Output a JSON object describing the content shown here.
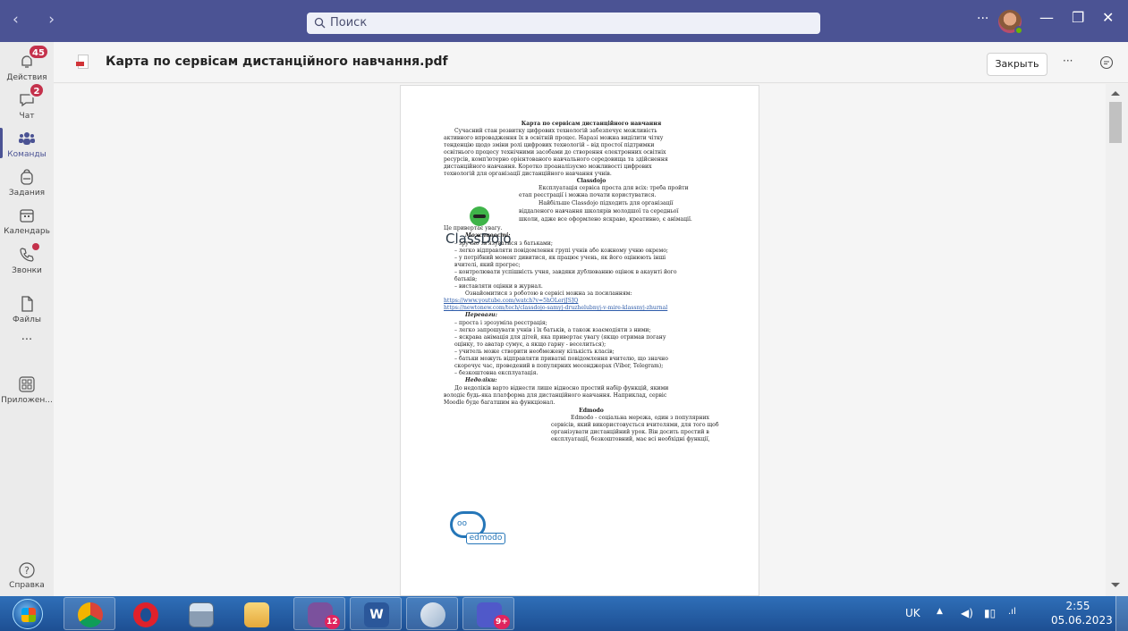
{
  "titlebar": {
    "search_placeholder": "Поиск",
    "more": "···",
    "nav": "‹  ›"
  },
  "rail": {
    "items": [
      {
        "label": "Действия",
        "badge": "45"
      },
      {
        "label": "Чат",
        "badge": "2"
      },
      {
        "label": "Команды",
        "active": true
      },
      {
        "label": "Задания"
      },
      {
        "label": "Календарь"
      },
      {
        "label": "Звонки",
        "dot": true
      },
      {
        "label": "Файлы"
      },
      {
        "label": "···"
      },
      {
        "label": "Приложен..."
      }
    ],
    "help": "Справка"
  },
  "header": {
    "title": "Карта по сервісам дистанційного навчання.pdf",
    "close": "Закрыть",
    "more": "···"
  },
  "document": {
    "title": "Карта по сервісам дистанційного навчання",
    "intro": [
      "Сучасний стан розвитку цифрових технологій забезпечує можливість",
      "активного впровадження їх в освітній процес. Наразі можна виділити чітку",
      "тенденцію щодо зміни ролі цифрових технологій – від простої підтримки",
      "освітнього процесу технічними засобами до створення електронних освітніх",
      "ресурсів, комп'ютерно орієнтованого навчального середовища та здійснення",
      "дистанційного навчання. Коротко проаналізуємо можливості цифрових",
      "технологій для організації дистанційного навчання учнів."
    ],
    "classdojo_heading": "Classdojo",
    "classdojo_logo": "ClassDojo",
    "classdojo_text": [
      "Експлуатація сервіса проста для всіх: треба пройти",
      "етап реєстрації і можна почати користуватися.",
      "Найбільше Classdojo підходить для організації",
      "віддаленого навчання школярів молодшої та середньої",
      "школи, адже все оформлено яскраво, креативно, є анімації.",
      "Це привертає увагу."
    ],
    "features_heading": "Можливості:",
    "features": [
      "–  зручно зв'язуватися з батьками;",
      "–  легко відправляти повідомлення групі учнів або кожному учню окремо;",
      "–  у потрібний момент дивитися, як працює учень, як його оцінюють інші",
      "    вчителі, який прогрес;",
      "–  контролювати успішність учня, завдяки дублюванню оцінок в акаунті його",
      "    батьків;",
      "–  виставляти оцінки в журнал."
    ],
    "links_intro": "Ознайомитися з роботою в сервісі можна за посиланням:",
    "links": [
      "https://www.youtube.com/watch?v=5hOLerjJSJQ",
      "https://newtonew.com/tech/classdojo-samyj-druzhelubnyj-v-mire-klassnyj-zhurnal"
    ],
    "advantages_heading": "Переваги:",
    "advantages": [
      "–  проста і зрозуміла реєстрація;",
      "–  легко запрошувати учнів і їх батьків, а також взаємодіяти з ними;",
      "–  яскрава анімація для дітей, яка привертає увагу (якщо отримав погану",
      "    оцінку, то аватар сумує, а якщо гарну - веселиться);",
      "–  учитель може створити необмежену кількість класів;",
      "–  батьки можуть відправляти приватні повідомлення вчителю, що значно",
      "    скорочує час, проведений в популярних месенджерах (Viber, Telegram);",
      "–  безкоштовна експлуатація."
    ],
    "drawbacks_heading": "Недоліки:",
    "drawbacks": [
      "До недоліків варто віднести лише відносно простий набір функцій, якими",
      "володіє будь-яка платформа для дистанційного навчання. Наприклад, сервіс",
      "Moodle буде багатшим на функціонал."
    ],
    "edmodo_heading": "Edmodo",
    "edmodo_logo": "edmodo",
    "edmodo_text": [
      "Edmodo - соціальна мережа, один з популярних",
      "сервісів, який використовується вчителями, для того щоб",
      "організувати дистанційний урок. Він досить простий в",
      "експлуатації, безкоштовний, має всі необхідні функції,"
    ]
  },
  "taskbar": {
    "apps": [
      {
        "name": "chrome",
        "badge": ""
      },
      {
        "name": "opera",
        "badge": ""
      },
      {
        "name": "calculator",
        "badge": ""
      },
      {
        "name": "explorer",
        "badge": ""
      },
      {
        "name": "viber",
        "badge": "12"
      },
      {
        "name": "word",
        "badge": ""
      },
      {
        "name": "snipping-tool",
        "badge": ""
      },
      {
        "name": "teams",
        "badge": "9+"
      }
    ],
    "lang": "UK",
    "time": "2:55",
    "date": "05.06.2023"
  },
  "colors": {
    "titlebar": "#4b5394",
    "accent": "#4b5394",
    "badge": "#c4314b",
    "link": "#2e5caa",
    "taskbar": "#1d4f93"
  }
}
